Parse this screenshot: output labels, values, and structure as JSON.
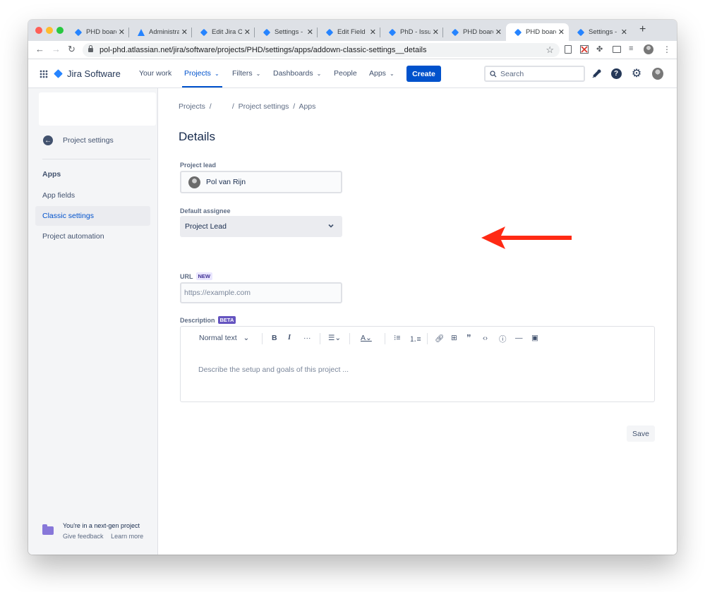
{
  "browser": {
    "tabs": [
      {
        "title": "PHD board",
        "icon": "jira"
      },
      {
        "title": "Administrat",
        "icon": "atlassian"
      },
      {
        "title": "Edit Jira C",
        "icon": "jira"
      },
      {
        "title": "Settings -",
        "icon": "jira"
      },
      {
        "title": "Edit Field",
        "icon": "jira"
      },
      {
        "title": "PhD - Issu",
        "icon": "jira"
      },
      {
        "title": "PHD board",
        "icon": "jira"
      },
      {
        "title": "PHD board",
        "icon": "jira",
        "active": true
      },
      {
        "title": "Settings -",
        "icon": "jira"
      }
    ],
    "url": "pol-phd.atlassian.net/jira/software/projects/PHD/settings/apps/addown-classic-settings__details"
  },
  "header": {
    "product": "Jira Software",
    "nav": {
      "your_work": "Your work",
      "projects": "Projects",
      "filters": "Filters",
      "dashboards": "Dashboards",
      "people": "People",
      "apps": "Apps"
    },
    "create": "Create",
    "search_placeholder": "Search"
  },
  "sidebar": {
    "back_label": "Project settings",
    "section_heading": "Apps",
    "items": [
      "App fields",
      "Classic settings",
      "Project automation"
    ],
    "selected_index": 1,
    "footer_title": "You're in a next-gen project",
    "footer_feedback": "Give feedback",
    "footer_learn": "Learn more"
  },
  "main": {
    "breadcrumbs": [
      "Projects",
      "",
      "Project settings",
      "Apps"
    ],
    "title": "Details",
    "project_lead_label": "Project lead",
    "project_lead_value": "Pol van Rijn",
    "default_assignee_label": "Default assignee",
    "default_assignee_value": "Project Lead",
    "url_label": "URL",
    "url_badge": "NEW",
    "url_placeholder": "https://example.com",
    "description_label": "Description",
    "description_badge": "BETA",
    "editor_text_style": "Normal text",
    "description_placeholder": "Describe the setup and goals of this project ...",
    "save": "Save"
  },
  "colors": {
    "accent": "#0052cc",
    "annotation_arrow": "#ff2a14",
    "sidebar_bg": "#f4f5f7"
  }
}
